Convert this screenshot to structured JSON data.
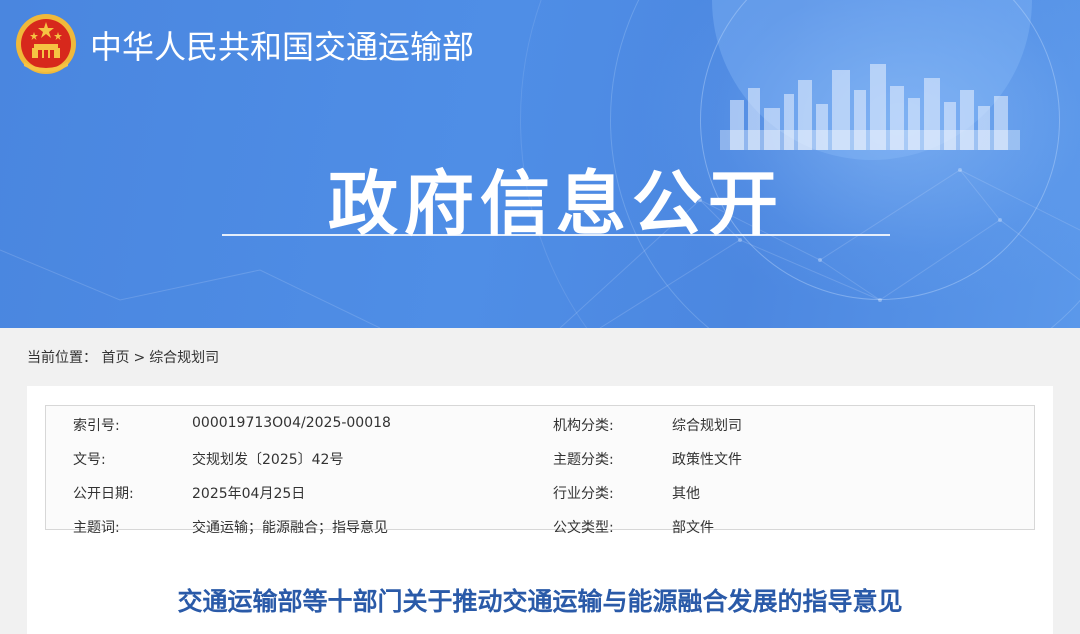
{
  "header": {
    "ministry_name": "中华人民共和国交通运输部",
    "portal_title": "政府信息公开"
  },
  "breadcrumb": {
    "label": "当前位置：",
    "items": [
      "首页",
      "综合规划司"
    ],
    "separator": ">"
  },
  "meta": {
    "rows": [
      {
        "k1": "索引号:",
        "v1": "000019713O04/2025-00018",
        "k2": "机构分类:",
        "v2": "综合规划司"
      },
      {
        "k1": "文号:",
        "v1": "交规划发〔2025〕42号",
        "k2": "主题分类:",
        "v2": "政策性文件"
      },
      {
        "k1": "公开日期:",
        "v1": "2025年04月25日",
        "k2": "行业分类:",
        "v2": "其他"
      },
      {
        "k1": "主题词:",
        "v1": "交通运输；能源融合；指导意见",
        "k2": "公文类型:",
        "v2": "部文件"
      }
    ]
  },
  "document": {
    "title": "交通运输部等十部门关于推动交通运输与能源融合发展的指导意见"
  },
  "colors": {
    "banner": "#4f8ee6",
    "title_blue": "#2a5aa8",
    "emblem_red": "#d7281c",
    "emblem_gold": "#f6c343"
  }
}
